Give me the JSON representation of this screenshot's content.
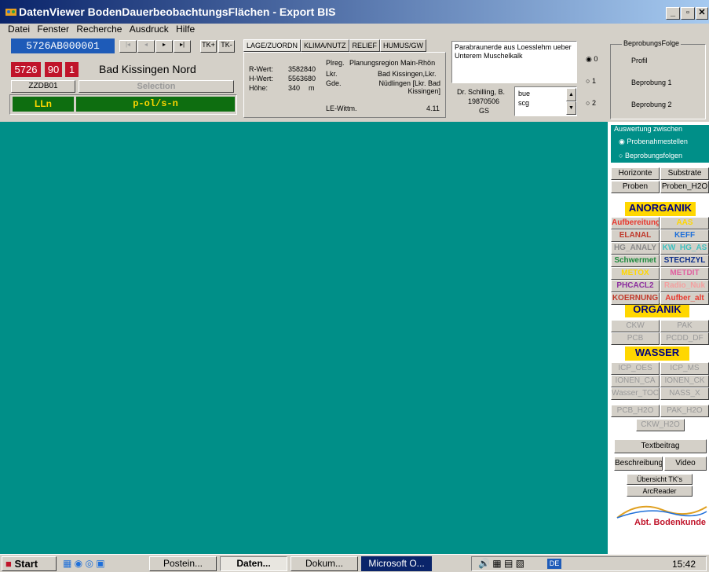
{
  "window": {
    "title": "DatenViewer BodenDauerbeobachtungsFlächen - Export BIS",
    "controls": {
      "minimize": "_",
      "maximize": "▫",
      "close": "✕"
    }
  },
  "menu": [
    "Datei",
    "Fenster",
    "Recherche",
    "Ausdruck",
    "Hilfe"
  ],
  "record": {
    "id": "5726AB000001",
    "nav": [
      "|◂",
      "◂",
      "▸",
      "▸|"
    ],
    "tk_plus": "TK+",
    "tk_minus": "TK-",
    "codes": [
      "5726",
      "90",
      "1"
    ],
    "name": "Bad Kissingen Nord",
    "zzdb": "ZZDB01",
    "selection": "Selection",
    "lln": "LLn",
    "profile": "p-ol/s-n"
  },
  "tabs": [
    "LAGE/ZUORDN",
    "KLIMA/NUTZ",
    "RELIEF",
    "HUMUS/GW"
  ],
  "lage": {
    "r_label": "R-Wert:",
    "r_value": "3582840",
    "h_label": "H-Wert:",
    "h_value": "5563680",
    "hoehe_label": "Höhe:",
    "hoehe_value": "340",
    "hoehe_unit": "m",
    "preg_label": "Plreg.",
    "preg_value": "Planungsregion Main-Rhön",
    "lkr_label": "Lkr.",
    "lkr_value": "Bad Kissingen,Lkr.",
    "gde_label": "Gde.",
    "gde_value": "Nüdlingen [Lkr. Bad Kissingen]",
    "le_label": "LE-Wittm.",
    "le_value": "4.11"
  },
  "description": "Parabraunerde aus Loesslehm ueber Unterem Muschelkalk",
  "author": {
    "name": "Dr. Schilling, B.",
    "date": "19870506",
    "code": "GS"
  },
  "list_items": [
    "bue",
    "scg"
  ],
  "radios": [
    {
      "label": "0",
      "checked": true
    },
    {
      "label": "1",
      "checked": false
    },
    {
      "label": "2",
      "checked": false
    }
  ],
  "beprobung": {
    "title": "BeprobungsFolge",
    "items": [
      "Profil",
      "Beprobung 1",
      "Beprobung 2"
    ]
  },
  "auswertung": {
    "title": "Auswertung zwischen",
    "options": [
      {
        "label": "Probenahmestellen",
        "checked": true
      },
      {
        "label": "Beprobungsfolgen",
        "checked": false
      }
    ]
  },
  "right_buttons": {
    "row1": [
      "Horizonte",
      "Substrate"
    ],
    "row2": [
      "Proben",
      "Proben_H2O"
    ],
    "anorganik_title": "ANORGANIK",
    "anorganik": [
      {
        "label": "Aufbereitung",
        "color": "#e8382e"
      },
      {
        "label": "AAS",
        "color": "#ffd700"
      },
      {
        "label": "ELANAL",
        "color": "#c0392b"
      },
      {
        "label": "KEFF",
        "color": "#1e6fd9"
      },
      {
        "label": "HG_ANALY",
        "color": "#8a8a8a"
      },
      {
        "label": "KW_HG_AS",
        "color": "#40c0c0"
      },
      {
        "label": "Schwermet",
        "color": "#1e8a3c"
      },
      {
        "label": "STECHZYL",
        "color": "#0e2f8a"
      },
      {
        "label": "METOX",
        "color": "#ffd700"
      },
      {
        "label": "METDIT",
        "color": "#e060a0"
      },
      {
        "label": "PHCACL2",
        "color": "#8e2fa0"
      },
      {
        "label": "Radio_Nuk",
        "color": "#f4a0a0"
      },
      {
        "label": "KOERNUNG",
        "color": "#c0392b"
      },
      {
        "label": "Aufber_alt",
        "color": "#e8382e"
      }
    ],
    "organik_title": "ORGANIK",
    "organik": [
      "CKW",
      "PAK",
      "PCB",
      "PCDD_DF"
    ],
    "wasser_title": "WASSER",
    "wasser": [
      "ICP_OES",
      "ICP_MS",
      "IONEN_CA",
      "IONEN_CK",
      "Wasser_TOC",
      "NASS_X"
    ],
    "h2o": [
      "PCB_H2O",
      "PAK_H2O"
    ],
    "ckw_h2o": "CKW_H2O",
    "textbeitrag": "Textbeitrag",
    "beschreibung": "Beschreibung",
    "video": "Video",
    "uebersicht": "Übersicht TK's",
    "arcreader": "ArcReader",
    "logo_text": "Abt. Bodenkunde"
  },
  "taskbar": {
    "start": "Start",
    "tasks": [
      {
        "label": "Postein...",
        "active": false
      },
      {
        "label": "Daten...",
        "active": true
      },
      {
        "label": "Dokum...",
        "active": false
      },
      {
        "label": "Microsoft O...",
        "active": false,
        "highlight": true
      }
    ],
    "tray_lang": "DE",
    "clock": "15:42"
  },
  "colors": {
    "teal": "#008f88",
    "navy": "#0a246a",
    "record_blue": "#1e5bb8",
    "code_red": "#c0142a",
    "green_bar": "#0e6e10",
    "yellow_text": "#ffd700"
  }
}
